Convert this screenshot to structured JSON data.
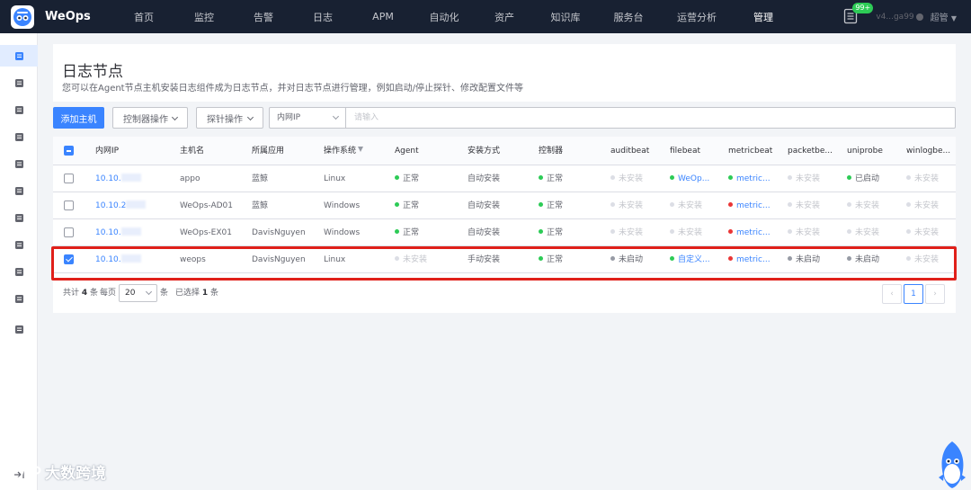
{
  "brand": {
    "name": "WeOps"
  },
  "nav": {
    "items": [
      "首页",
      "监控",
      "告警",
      "日志",
      "APM",
      "自动化",
      "资产",
      "知识库",
      "服务台",
      "运营分析",
      "管理"
    ],
    "active_index": 10
  },
  "topright": {
    "badge": "99+",
    "version": "v4...ga99",
    "user": "超管"
  },
  "sidebar": {
    "icons": [
      "cluster-icon",
      "monitor-icon",
      "alarm-icon",
      "checklist-icon",
      "book-icon",
      "briefcase-icon",
      "layers-icon",
      "document-icon",
      "clipboard-icon",
      "chart-icon",
      "settings-icon"
    ],
    "active_index": 0
  },
  "header": {
    "title": "日志节点",
    "description": "您可以在Agent节点主机安装日志组件成为日志节点，并对日志节点进行管理，例如启动/停止探针、修改配置文件等"
  },
  "toolbar": {
    "add_label": "添加主机",
    "controller_ops_label": "控制器操作",
    "probe_ops_label": "探针操作",
    "search_field": "内网IP",
    "search_placeholder": "请输入"
  },
  "table": {
    "headers": [
      "内网IP",
      "主机名",
      "所属应用",
      "操作系统",
      "Agent",
      "安装方式",
      "控制器",
      "auditbeat",
      "filebeat",
      "metricbeat",
      "packetbe...",
      "uniprobe",
      "winlogbe..."
    ],
    "rows": [
      {
        "ip": "10.10.",
        "host": "appo",
        "app": "蓝鲸",
        "os": "Linux",
        "agent": "正常",
        "install": "自动安装",
        "controller": "正常",
        "auditbeat": "未安装",
        "filebeat": "WeOp...",
        "metricbeat": "metric...",
        "packetbeat": "未安装",
        "uniprobe": "已启动",
        "winlogbeat": "未安装",
        "checked": false
      },
      {
        "ip": "10.10.2",
        "host": "WeOps-AD01",
        "app": "蓝鲸",
        "os": "Windows",
        "agent": "正常",
        "install": "自动安装",
        "controller": "正常",
        "auditbeat": "未安装",
        "filebeat": "未安装",
        "metricbeat": "metric...",
        "packetbeat": "未安装",
        "uniprobe": "未安装",
        "winlogbeat": "未安装",
        "checked": false
      },
      {
        "ip": "10.10.",
        "host": "WeOps-EX01",
        "app": "DavisNguyen",
        "os": "Windows",
        "agent": "正常",
        "install": "自动安装",
        "controller": "正常",
        "auditbeat": "未安装",
        "filebeat": "未安装",
        "metricbeat": "metric...",
        "packetbeat": "未安装",
        "uniprobe": "未安装",
        "winlogbeat": "未安装",
        "checked": false
      },
      {
        "ip": "10.10.",
        "host": "weops",
        "app": "DavisNguyen",
        "os": "Linux",
        "agent": "未安装",
        "install": "手动安装",
        "controller": "正常",
        "auditbeat": "未启动",
        "filebeat": "自定义...",
        "metricbeat": "metric...",
        "packetbeat": "未启动",
        "uniprobe": "未启动",
        "winlogbeat": "未安装",
        "checked": true
      }
    ]
  },
  "pagination": {
    "total_prefix": "共计",
    "total": "4",
    "total_suffix": "条",
    "per_page_prefix": "每页",
    "per_page": "20",
    "per_page_suffix": "条",
    "selected_prefix": "已选择",
    "selected": "1",
    "selected_suffix": "条",
    "current_page": "1"
  },
  "watermark": "大数跨境",
  "colors": {
    "primary": "#3a84ff",
    "success": "#2dcb56",
    "danger": "#ea3636",
    "muted": "#c4c6cc",
    "nav_bg": "#182132",
    "highlight": "#e0201a"
  }
}
